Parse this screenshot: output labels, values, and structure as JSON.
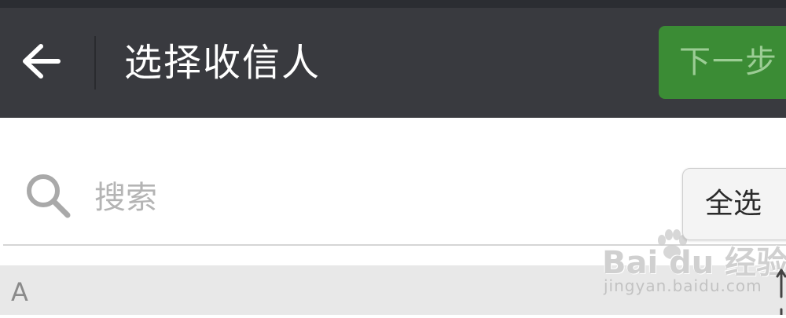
{
  "header": {
    "title": "选择收信人",
    "next_label": "下一步"
  },
  "search": {
    "placeholder": "搜索",
    "value": ""
  },
  "select_all_label": "全选",
  "contacts": {
    "sections": [
      {
        "letter": "A"
      }
    ]
  },
  "watermark": {
    "brand": "Bai du 经验",
    "url": "jingyan.baidu.com"
  },
  "icons": {
    "back": "arrow-left-icon",
    "search": "magnifier-icon",
    "index": "arrow-up-icon",
    "watermark": "paw-icon"
  },
  "colors": {
    "header_bg": "#393a3f",
    "status_bg": "#2b2d32",
    "accent_green": "#3b8c35",
    "accent_green_text": "#9ccd95",
    "section_bg": "#e8e8e8",
    "placeholder": "#b4b4b4"
  }
}
